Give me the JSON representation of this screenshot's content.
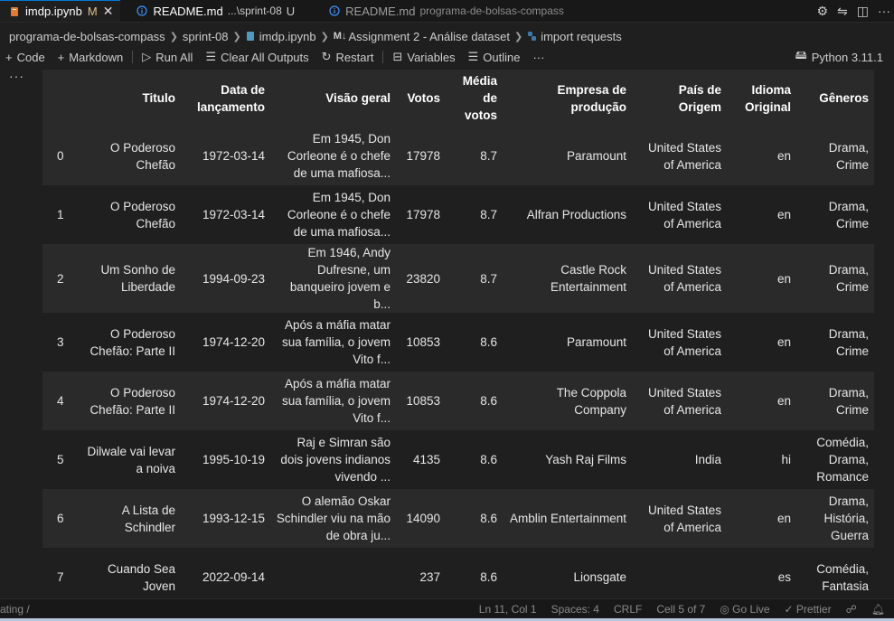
{
  "tabs": [
    {
      "label": "imdp.ipynb",
      "status": "M",
      "sub": "",
      "active": true
    },
    {
      "label": "README.md",
      "status": "U",
      "sub": "...\\sprint-08",
      "active": false
    },
    {
      "label": "README.md",
      "status": "",
      "sub": "programa-de-bolsas-compass",
      "active": false
    }
  ],
  "tab_actions": [
    "gear-icon",
    "branch-compare-icon",
    "split-editor-icon",
    "more-icon"
  ],
  "breadcrumb": {
    "items": [
      "programa-de-bolsas-compass",
      "sprint-08",
      "imdp.ipynb",
      "Assignment 2 - Análise dataset",
      "import requests"
    ],
    "md_badge": "M↓"
  },
  "toolbar": {
    "code": "Code",
    "markdown": "Markdown",
    "run_all": "Run All",
    "clear_outputs": "Clear All Outputs",
    "restart": "Restart",
    "variables": "Variables",
    "outline": "Outline",
    "more": "···",
    "kernel": "Python 3.11.1"
  },
  "cell_gutter": "···",
  "table": {
    "columns": [
      "Titulo",
      "Data de lançamento",
      "Visão geral",
      "Votos",
      "Média de votos",
      "Empresa de produção",
      "País de Origem",
      "Idioma Original",
      "Gêneros"
    ],
    "rows": [
      {
        "idx": "0",
        "cells": [
          "O Poderoso Chefão",
          "1972-03-14",
          "Em 1945, Don Corleone é o chefe de uma mafiosa...",
          "17978",
          "8.7",
          "Paramount",
          "United States of America",
          "en",
          "Drama, Crime"
        ]
      },
      {
        "idx": "1",
        "cells": [
          "O Poderoso Chefão",
          "1972-03-14",
          "Em 1945, Don Corleone é o chefe de uma mafiosa...",
          "17978",
          "8.7",
          "Alfran Productions",
          "United States of America",
          "en",
          "Drama, Crime"
        ]
      },
      {
        "idx": "2",
        "cells": [
          "Um Sonho de Liberdade",
          "1994-09-23",
          "Em 1946, Andy Dufresne, um banqueiro jovem e b...",
          "23820",
          "8.7",
          "Castle Rock Entertainment",
          "United States of America",
          "en",
          "Drama, Crime"
        ]
      },
      {
        "idx": "3",
        "cells": [
          "O Poderoso Chefão: Parte II",
          "1974-12-20",
          "Após a máfia matar sua família, o jovem Vito f...",
          "10853",
          "8.6",
          "Paramount",
          "United States of America",
          "en",
          "Drama, Crime"
        ]
      },
      {
        "idx": "4",
        "cells": [
          "O Poderoso Chefão: Parte II",
          "1974-12-20",
          "Após a máfia matar sua família, o jovem Vito f...",
          "10853",
          "8.6",
          "The Coppola Company",
          "United States of America",
          "en",
          "Drama, Crime"
        ]
      },
      {
        "idx": "5",
        "cells": [
          "Dilwale vai levar a noiva",
          "1995-10-19",
          "Raj e Simran são dois jovens indianos vivendo ...",
          "4135",
          "8.6",
          "Yash Raj Films",
          "India",
          "hi",
          "Comédia, Drama, Romance"
        ]
      },
      {
        "idx": "6",
        "cells": [
          "A Lista de Schindler",
          "1993-12-15",
          "O alemão Oskar Schindler viu na mão de obra ju...",
          "14090",
          "8.6",
          "Amblin Entertainment",
          "United States of America",
          "en",
          "Drama, História, Guerra"
        ]
      },
      {
        "idx": "7",
        "cells": [
          "Cuando Sea Joven",
          "2022-09-14",
          "",
          "237",
          "8.6",
          "Lionsgate",
          "",
          "es",
          "Comédia, Fantasia"
        ]
      }
    ]
  },
  "statusbar": {
    "left": "ating /",
    "position": "Ln 11, Col 1",
    "spaces": "Spaces: 4",
    "eol": "CRLF",
    "cell": "Cell 5 of 7",
    "go_live": "Go Live",
    "prettier": "Prettier"
  },
  "colors": {
    "background": "#1f1f1f",
    "tab_bar": "#181818",
    "active_tab_border": "#0078d4",
    "modified": "#e2c08d",
    "row_stripe": "#2a2a2a"
  }
}
